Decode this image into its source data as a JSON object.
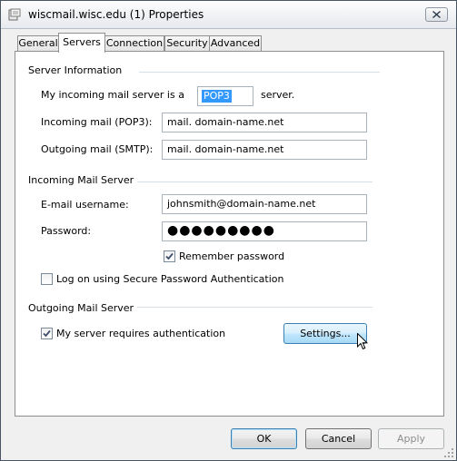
{
  "window": {
    "title": "wiscmail.wisc.edu (1) Properties"
  },
  "tabs": [
    {
      "label": "General",
      "active": false
    },
    {
      "label": "Servers",
      "active": true
    },
    {
      "label": "Connection",
      "active": false
    },
    {
      "label": "Security",
      "active": false
    },
    {
      "label": "Advanced",
      "active": false
    }
  ],
  "server_info": {
    "group_title": "Server Information",
    "incoming_type_prefix": "My incoming mail server is a",
    "incoming_type_value": "POP3",
    "incoming_type_suffix": "server.",
    "incoming_label": "Incoming mail (POP3):",
    "incoming_value": "mail. domain-name.net",
    "outgoing_label": "Outgoing mail (SMTP):",
    "outgoing_value": "mail. domain-name.net"
  },
  "incoming_server": {
    "group_title": "Incoming Mail Server",
    "username_label": "E-mail username:",
    "username_value": "johnsmith@domain-name.net",
    "password_label": "Password:",
    "password_value": "●●●●●●●●●",
    "remember_label": "Remember password",
    "remember_checked": true,
    "spa_label": "Log on using Secure Password Authentication",
    "spa_checked": false
  },
  "outgoing_server": {
    "group_title": "Outgoing Mail Server",
    "auth_label": "My server requires authentication",
    "auth_checked": true,
    "settings_label": "Settings..."
  },
  "footer": {
    "ok_label": "OK",
    "cancel_label": "Cancel",
    "apply_label": "Apply"
  },
  "colors": {
    "selection": "#3399ff",
    "panel_border": "#8e8f8f",
    "button_hover": "#bee6fd"
  }
}
